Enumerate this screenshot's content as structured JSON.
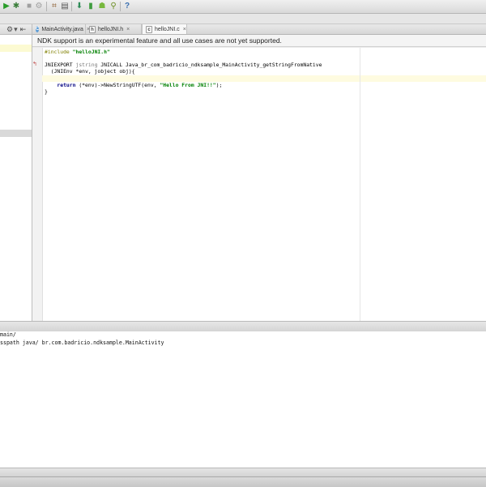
{
  "colors": {
    "notice_bg": "#f4f4f4",
    "caret_line": "#fefbe0",
    "string": "#008000",
    "keyword": "#000080",
    "preprocessor": "#808000"
  },
  "toolbar": {
    "icons": [
      "run-icon",
      "debug-icon",
      "stop-icon",
      "make-icon",
      "structure-icon",
      "sdk-manager-icon",
      "avd-manager-icon",
      "android-icon",
      "help-icon"
    ],
    "help_label": "?"
  },
  "tabs": [
    {
      "label": "MainActivity.java",
      "icon": "class-icon",
      "close": "×"
    },
    {
      "label": "helloJNI.h",
      "icon": "header-file-icon",
      "close": "×"
    },
    {
      "label": "helloJNI.c",
      "icon": "c-file-icon",
      "close": "×"
    }
  ],
  "notice": {
    "text": "NDK support is an experimental feature and all use cases are not yet supported."
  },
  "editor": {
    "lines": {
      "l1_pre": "#include ",
      "l1_str": "\"helloJNI.h\"",
      "l2": "",
      "l3": "JNIEXPORT ",
      "l3_dim": "jstring",
      "l3_rest": " JNICALL Java_br_com_badricio_ndksample_MainActivity_getStringFromNative",
      "l4": "  (JNIEnv *env, jobject obj){",
      "l5": "",
      "l6_kw": "    return",
      "l6_rest": " (*env)->NewStringUTF(env, ",
      "l6_str": "\"Hello From JNI!!\"",
      "l6_end": ");",
      "l7": "}"
    }
  },
  "console": {
    "lines": [
      "main/",
      "sspath java/ br.com.badricio.ndksample.MainActivity"
    ]
  }
}
